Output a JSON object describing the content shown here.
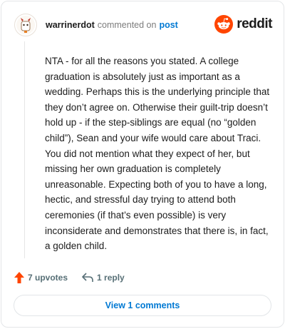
{
  "header": {
    "username": "warrinerdot",
    "verb": "commented on",
    "post_link": "post"
  },
  "brand": {
    "name": "reddit",
    "icon": "reddit-snoo-icon",
    "color": "#ff4500"
  },
  "comment": {
    "body": "NTA - for all the reasons you stated. A college graduation is absolutely just as important as a wedding. Perhaps this is the underlying principle that they don’t agree on. Otherwise their guilt-trip doesn’t hold up - if the step-siblings are equal (no “golden child”), Sean and your wife would care about Traci. You did not mention what they expect of her, but missing her own graduation is completely unreasonable. Expecting both of you to have a long, hectic, and stressful day trying to attend both ceremonies (if that’s even possible) is very inconsiderate and demonstrates that there is, in fact, a golden child."
  },
  "actions": {
    "upvotes": "7 upvotes",
    "upvote_icon": "upvote-arrow-icon",
    "upvote_color": "#ff4500",
    "reply": "1 reply",
    "reply_icon": "reply-arrow-icon"
  },
  "footer": {
    "view_comments": "View 1 comments",
    "link_color": "#0079d3"
  }
}
